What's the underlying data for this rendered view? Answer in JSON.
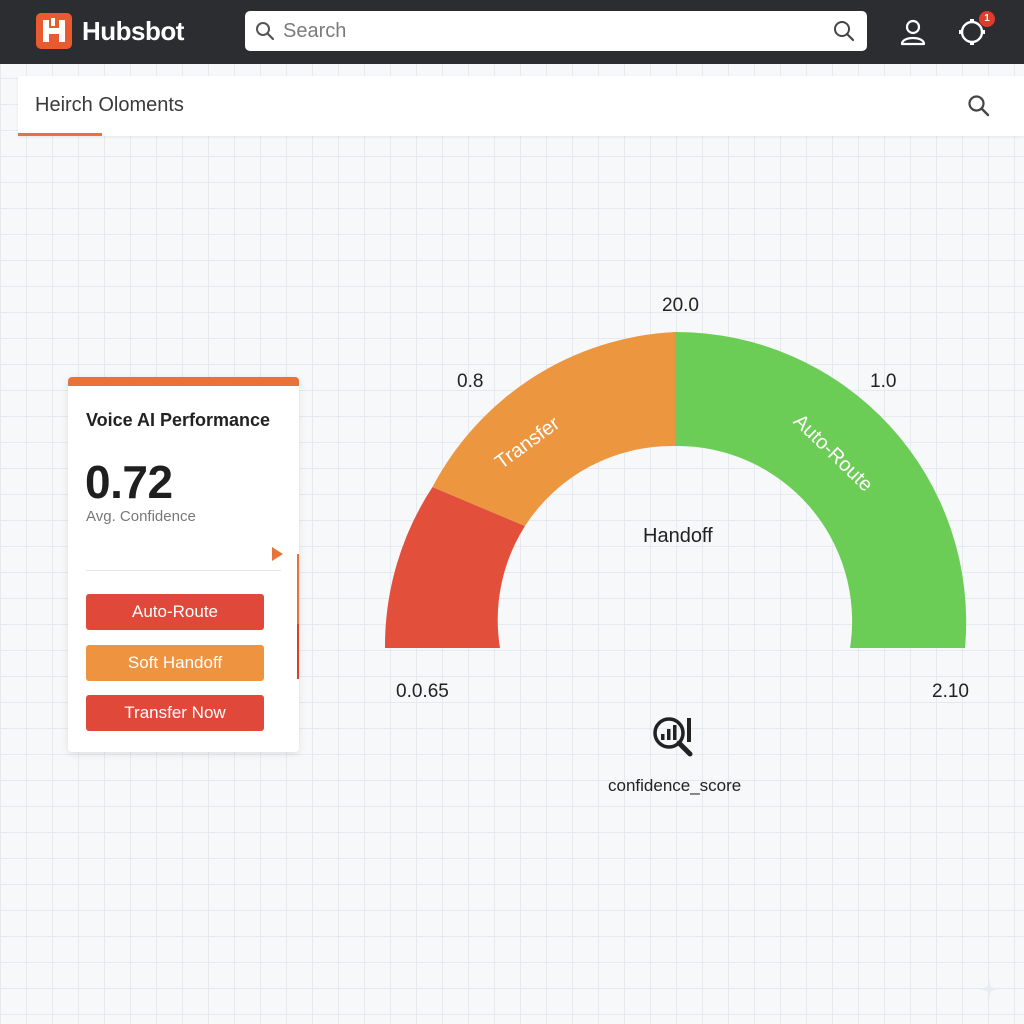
{
  "app": {
    "name": "Hubsbot",
    "logo_icon": "hubspot-logo-icon",
    "brand_color": "#ea5a2f"
  },
  "topbar": {
    "search_placeholder": "Search",
    "notification_count": "1"
  },
  "subheader": {
    "active_tab": "Heirch Oloments",
    "accent_color": "#e8733a"
  },
  "card": {
    "title": "Voice AI Performance",
    "value": "0.72",
    "value_label": "Avg. Confidence",
    "buttons": {
      "auto_route": "Auto-Route",
      "soft_handoff": "Soft Handoff",
      "transfer_now": "Transfer Now"
    }
  },
  "gauge": {
    "label_top": "20.0",
    "label_left": "0.8",
    "label_right": "1.0",
    "label_min": "0.0.65",
    "label_max": "2.10",
    "center_label": "Handoff",
    "band_transfer": "Transfer",
    "band_auto_route": "Auto-Route",
    "metric_name": "confidence_score",
    "colors": {
      "red": "#e2503c",
      "orange": "#ec9640",
      "green": "#6bcd55"
    }
  }
}
